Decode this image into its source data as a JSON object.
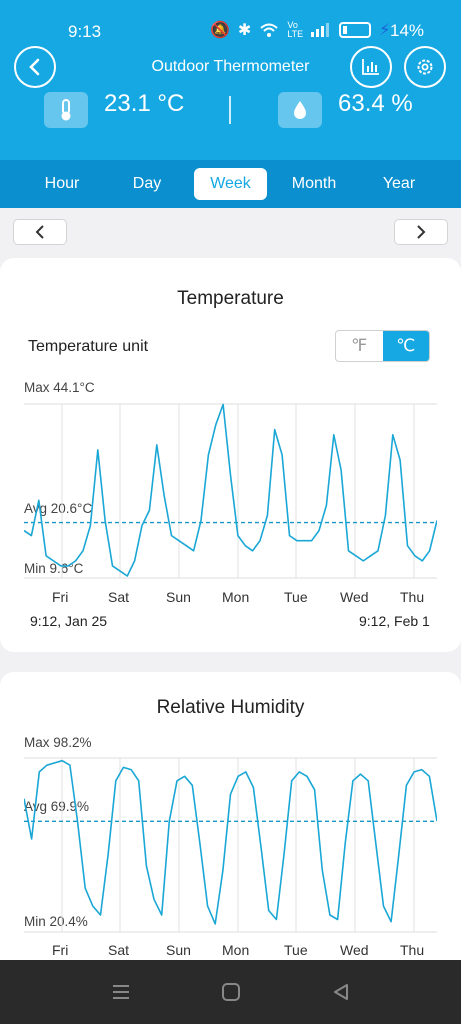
{
  "status": {
    "time": "9:13",
    "battery": "14%"
  },
  "header": {
    "title": "Outdoor Thermometer",
    "temperature": "23.1 °C",
    "humidity": "63.4 %"
  },
  "tabs": [
    "Hour",
    "Day",
    "Week",
    "Month",
    "Year"
  ],
  "active_tab": "Week",
  "colors": {
    "accent": "#15a8e3",
    "tab_bar": "#0b8fcf",
    "line": "#1aa7d6"
  },
  "temperature_card": {
    "title": "Temperature",
    "unit_label": "Temperature unit",
    "unit_f": "℉",
    "unit_c": "℃",
    "max": "Max 44.1°C",
    "avg": "Avg 20.6°C",
    "min": "Min 9.6°C",
    "days": [
      "Fri",
      "Sat",
      "Sun",
      "Mon",
      "Tue",
      "Wed",
      "Thu"
    ],
    "start": "9:12, Jan 25",
    "end": "9:12, Feb 1"
  },
  "humidity_card": {
    "title": "Relative Humidity",
    "max": "Max 98.2%",
    "avg": "Avg 69.9%",
    "min": "Min 20.4%",
    "days": [
      "Fri",
      "Sat",
      "Sun",
      "Mon",
      "Tue",
      "Wed",
      "Thu"
    ]
  },
  "chart_data": [
    {
      "type": "line",
      "title": "Temperature",
      "ylabel": "°C",
      "ylim": [
        9.6,
        44.1
      ],
      "avg": 20.6,
      "categories": [
        "Fri",
        "Sat",
        "Sun",
        "Mon",
        "Tue",
        "Wed",
        "Thu"
      ],
      "values": [
        19,
        18,
        25,
        14,
        13,
        12,
        12,
        13,
        15,
        20,
        35,
        21,
        12,
        11,
        10,
        13,
        20,
        23,
        36,
        26,
        18,
        17,
        16,
        15,
        21,
        34,
        40,
        44,
        30,
        18,
        16,
        15,
        17,
        22,
        39,
        34,
        18,
        17,
        17,
        17,
        19,
        24,
        38,
        31,
        15,
        14,
        13,
        14,
        15,
        22,
        38,
        33,
        16,
        14,
        13,
        15,
        21
      ]
    },
    {
      "type": "line",
      "title": "Relative Humidity",
      "ylabel": "%",
      "ylim": [
        20.4,
        98.2
      ],
      "avg": 69.9,
      "categories": [
        "Fri",
        "Sat",
        "Sun",
        "Mon",
        "Tue",
        "Wed",
        "Thu"
      ],
      "values": [
        80,
        62,
        92,
        95,
        96,
        97,
        95,
        70,
        40,
        32,
        28,
        55,
        88,
        94,
        93,
        88,
        50,
        35,
        28,
        70,
        88,
        90,
        86,
        60,
        32,
        24,
        48,
        82,
        90,
        92,
        85,
        58,
        30,
        26,
        55,
        88,
        92,
        90,
        84,
        48,
        28,
        26,
        60,
        88,
        91,
        88,
        60,
        32,
        25,
        55,
        86,
        92,
        93,
        90,
        70
      ]
    }
  ]
}
